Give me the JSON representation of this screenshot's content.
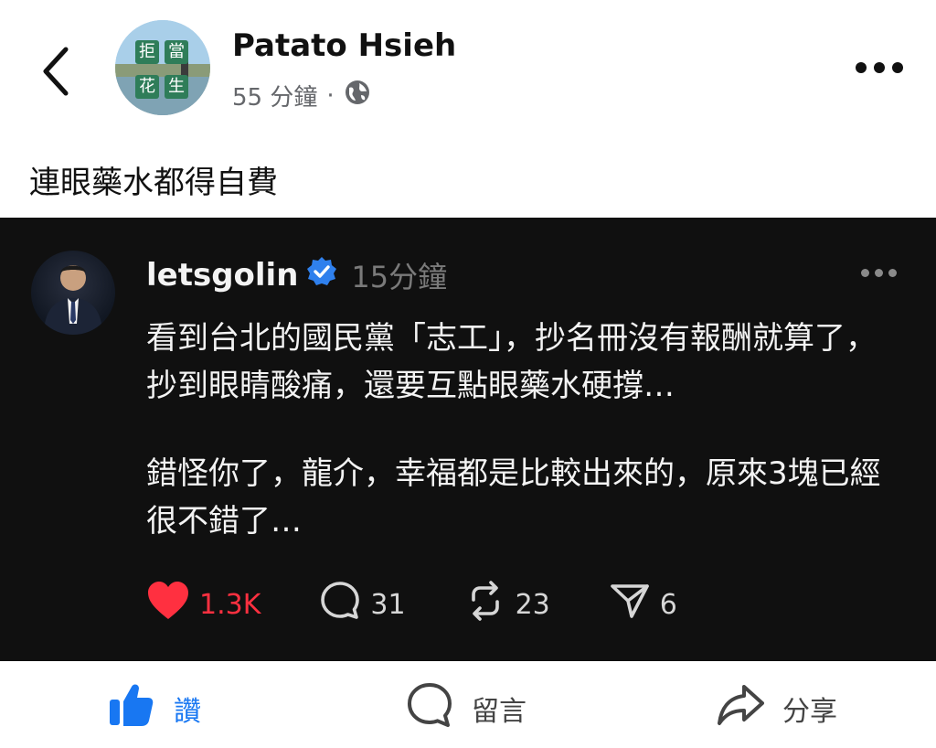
{
  "header": {
    "author": "Patato Hsieh",
    "time": "55 分鐘",
    "separator": "·",
    "avatar_chips": [
      "拒",
      "當",
      "花",
      "生"
    ]
  },
  "post": {
    "caption": "連眼藥水都得自費"
  },
  "embedded": {
    "username": "letsgolin",
    "time": "15分鐘",
    "paragraph1": "看到台北的國民黨「志工」，抄名冊沒有報酬就算了，抄到眼睛酸痛，還要互點眼藥水硬撐…",
    "paragraph2": "錯怪你了，龍介，幸福都是比較出來的，原來3塊已經很不錯了…",
    "likes": "1.3K",
    "replies": "31",
    "reposts": "23",
    "shares": "6",
    "colors": {
      "like": "#ff3040",
      "verified": "#2f80ed",
      "background": "#101010"
    }
  },
  "actionbar": {
    "like_label": "讚",
    "comment_label": "留言",
    "share_label": "分享",
    "colors": {
      "like": "#1877f2"
    }
  }
}
